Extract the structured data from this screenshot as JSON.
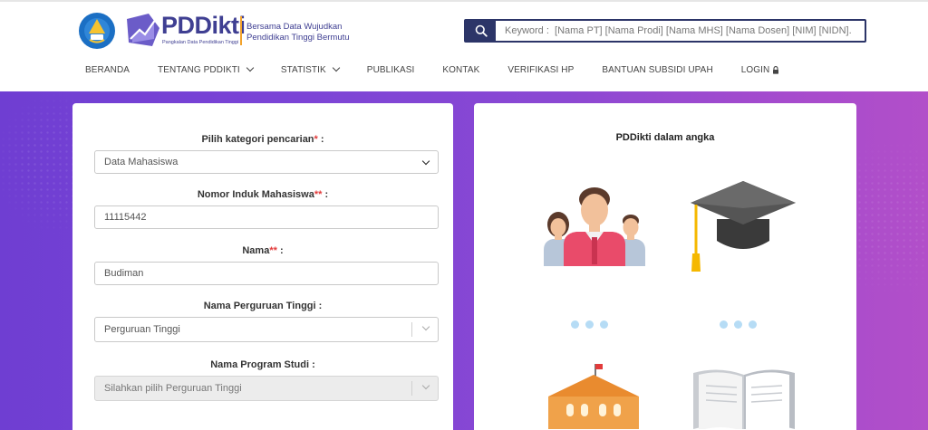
{
  "header": {
    "brand_name": "PDDikti",
    "brand_sub": "Pangkalan Data Pendidikan Tinggi",
    "tagline": "Bersama Data Wujudkan Pendidikan Tinggi Bermutu",
    "search_placeholder": "Keyword :  [Nama PT] [Nama Prodi] [Nama MHS] [Nama Dosen] [NIM] [NIDN].",
    "search_icon": "search-icon"
  },
  "nav": {
    "items": [
      {
        "label": "BERANDA",
        "caret": false
      },
      {
        "label": "TENTANG PDDIKTI",
        "caret": true
      },
      {
        "label": "STATISTIK",
        "caret": true
      },
      {
        "label": "PUBLIKASI",
        "caret": false
      },
      {
        "label": "KONTAK",
        "caret": false
      },
      {
        "label": "VERIFIKASI HP",
        "caret": false
      },
      {
        "label": "BANTUAN SUBSIDI UPAH",
        "caret": false
      },
      {
        "label": "LOGIN",
        "caret": false,
        "icon": "lock-icon"
      }
    ]
  },
  "form": {
    "category_label": "Pilih kategori pencarian",
    "category_req": "*",
    "category_suffix": " :",
    "category_value": "Data Mahasiswa",
    "nim_label": "Nomor Induk Mahasiswa",
    "nim_req": "**",
    "nim_suffix": " :",
    "nim_value": "11115442",
    "name_label": "Nama",
    "name_req": "**",
    "name_suffix": " :",
    "name_value": "Budiman",
    "pt_label": "Nama Perguruan Tinggi :",
    "pt_value": "Perguruan Tinggi",
    "prodi_label": "Nama Program Studi :",
    "prodi_value": "Silahkan pilih Perguruan Tinggi"
  },
  "stats": {
    "title": "PDDikti dalam angka",
    "icons": [
      "people-icon",
      "graduation-cap-icon",
      "university-building-icon",
      "book-icon"
    ]
  },
  "colors": {
    "brand": "#3f3f92",
    "search_border": "#2c3568",
    "required": "#e23b3b",
    "hero_start": "#6f3ed2",
    "hero_end": "#b24fc9",
    "loading_dot": "#b6dcf5"
  }
}
